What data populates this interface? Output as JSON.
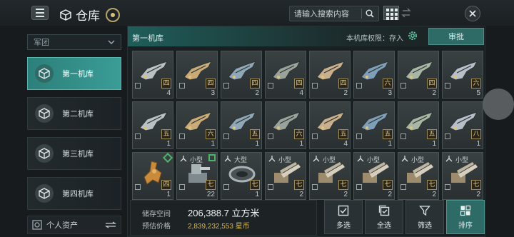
{
  "header": {
    "title": "仓库",
    "search_placeholder": "请输入搜索内容"
  },
  "sidebar": {
    "faction_label": "军团",
    "hangars": [
      {
        "label": "第一机库",
        "active": true
      },
      {
        "label": "第二机库",
        "active": false
      },
      {
        "label": "第三机库",
        "active": false
      },
      {
        "label": "第四机库",
        "active": false
      }
    ],
    "personal_assets": "个人资产"
  },
  "panel": {
    "hangar_name": "第一机库",
    "permission_label": "本机库权限：存入",
    "approve_label": "审批"
  },
  "items": [
    {
      "tier": "四",
      "qty": "4",
      "size": "",
      "kind": "ship1"
    },
    {
      "tier": "四",
      "qty": "3",
      "size": "",
      "kind": "ship2"
    },
    {
      "tier": "四",
      "qty": "2",
      "size": "",
      "kind": "ship3"
    },
    {
      "tier": "四",
      "qty": "4",
      "size": "",
      "kind": "ship4"
    },
    {
      "tier": "四",
      "qty": "2",
      "size": "",
      "kind": "ship5"
    },
    {
      "tier": "六",
      "qty": "3",
      "size": "",
      "kind": "ship6"
    },
    {
      "tier": "四",
      "qty": "2",
      "size": "",
      "kind": "ship7"
    },
    {
      "tier": "六",
      "qty": "5",
      "size": "",
      "kind": "ship8"
    },
    {
      "tier": "五",
      "qty": "1",
      "size": "",
      "kind": "ship9"
    },
    {
      "tier": "六",
      "qty": "1",
      "size": "",
      "kind": "ship10"
    },
    {
      "tier": "五",
      "qty": "1",
      "size": "",
      "kind": "ship11"
    },
    {
      "tier": "六",
      "qty": "1",
      "size": "",
      "kind": "ship12"
    },
    {
      "tier": "五",
      "qty": "4",
      "size": "",
      "kind": "ship13"
    },
    {
      "tier": "五",
      "qty": "1",
      "size": "",
      "kind": "ship14"
    },
    {
      "tier": "五",
      "qty": "1",
      "size": "",
      "kind": "ship15"
    },
    {
      "tier": "八",
      "qty": "1",
      "size": "",
      "kind": "ship16"
    },
    {
      "tier": "四",
      "qty": "1",
      "size": "",
      "kind": "mech",
      "mark": "diamond"
    },
    {
      "tier": "七",
      "qty": "22",
      "size": "小型",
      "kind": "turret",
      "mark": "square"
    },
    {
      "tier": "七",
      "qty": "1",
      "size": "大型",
      "kind": "ring"
    },
    {
      "tier": "七",
      "qty": "2",
      "size": "小型",
      "kind": "cannon"
    },
    {
      "tier": "七",
      "qty": "2",
      "size": "小型",
      "kind": "cannon"
    },
    {
      "tier": "七",
      "qty": "2",
      "size": "小型",
      "kind": "cannon"
    },
    {
      "tier": "七",
      "qty": "2",
      "size": "小型",
      "kind": "cannon"
    },
    {
      "tier": "七",
      "qty": "2",
      "size": "小型",
      "kind": "cannon"
    }
  ],
  "footer": {
    "storage_label": "储存空间",
    "storage_value": "206,388.7 立方米",
    "price_label": "预估价格",
    "price_value": "2,839,232,553 星币"
  },
  "actions": [
    {
      "label": "多选"
    },
    {
      "label": "全选"
    },
    {
      "label": "筛选"
    },
    {
      "label": "排序"
    }
  ]
}
